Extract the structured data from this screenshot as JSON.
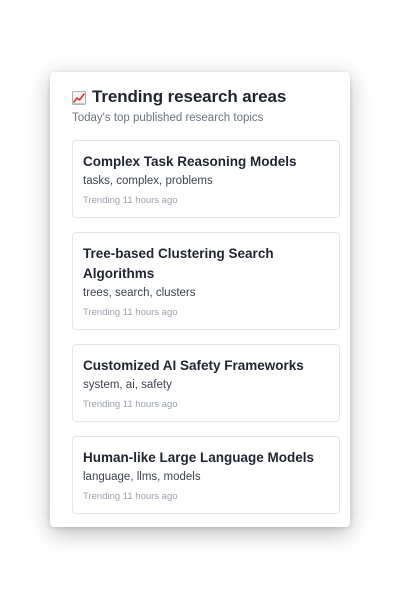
{
  "panel": {
    "icon": "chart-increasing-icon",
    "title": "Trending research areas",
    "subtitle": "Today's top published research topics"
  },
  "topics": [
    {
      "title": "Complex Task Reasoning Models",
      "tags": "tasks, complex, problems",
      "time": "Trending 11 hours ago"
    },
    {
      "title": "Tree-based Clustering Search Algorithms",
      "tags": "trees, search, clusters",
      "time": "Trending 11 hours ago"
    },
    {
      "title": "Customized AI Safety Frameworks",
      "tags": "system, ai, safety",
      "time": "Trending 11 hours ago"
    },
    {
      "title": "Human-like Large Language Models",
      "tags": "language, llms, models",
      "time": "Trending 11 hours ago"
    }
  ]
}
